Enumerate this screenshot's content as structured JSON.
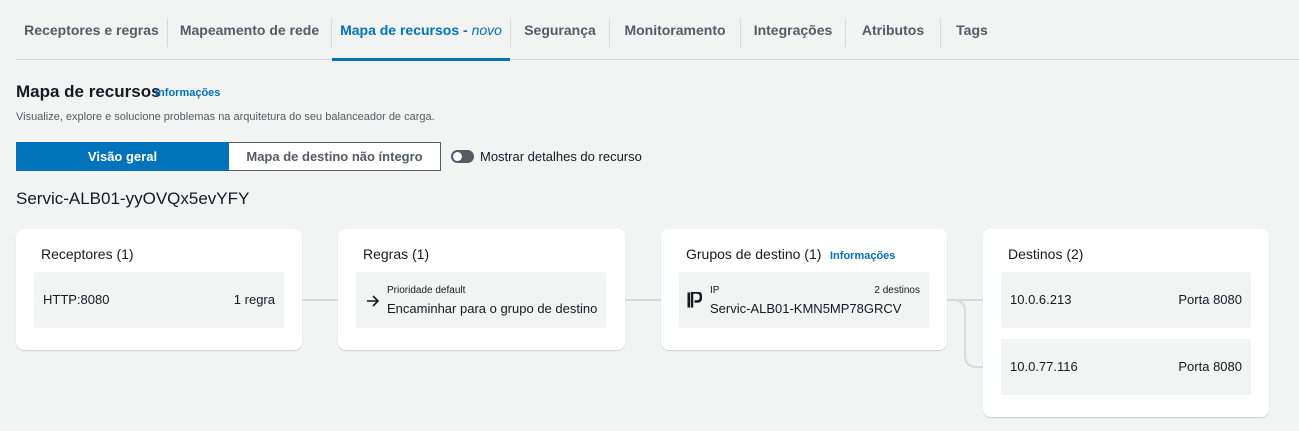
{
  "tabs": [
    {
      "label": "Receptores e regras"
    },
    {
      "label": "Mapeamento de rede"
    },
    {
      "label": "Mapa de recursos - ",
      "suffix": "novo"
    },
    {
      "label": "Segurança"
    },
    {
      "label": "Monitoramento"
    },
    {
      "label": "Integrações"
    },
    {
      "label": "Atributos"
    },
    {
      "label": "Tags"
    }
  ],
  "header": {
    "title": "Mapa de recursos",
    "info": "Informações",
    "description": "Visualize, explore e solucione problemas na arquitetura do seu balanceador de carga."
  },
  "segments": {
    "overview": "Visão geral",
    "unhealthy": "Mapa de destino não íntegro"
  },
  "toggle": {
    "label": "Mostrar detalhes do recurso",
    "on": false
  },
  "lb_name": "Servic-ALB01-yyOVQx5evYFY",
  "listeners": {
    "title": "Receptores (1)",
    "items": [
      {
        "name": "HTTP:8080",
        "rules": "1 regra"
      }
    ]
  },
  "rules": {
    "title": "Regras (1)",
    "items": [
      {
        "priority": "Prioridade default",
        "action": "Encaminhar para o grupo de destino"
      }
    ]
  },
  "target_groups": {
    "title": "Grupos de destino (1)",
    "info": "Informações",
    "items": [
      {
        "type": "IP",
        "count": "2 destinos",
        "name": "Servic-ALB01-KMN5MP78GRCV"
      }
    ]
  },
  "targets": {
    "title": "Destinos (2)",
    "items": [
      {
        "ip": "10.0.6.213",
        "port": "Porta 8080"
      },
      {
        "ip": "10.0.77.116",
        "port": "Porta 8080"
      }
    ]
  },
  "colors": {
    "accent": "#0073bb",
    "background": "#f2f3f3",
    "connector": "#d5dbdb"
  }
}
